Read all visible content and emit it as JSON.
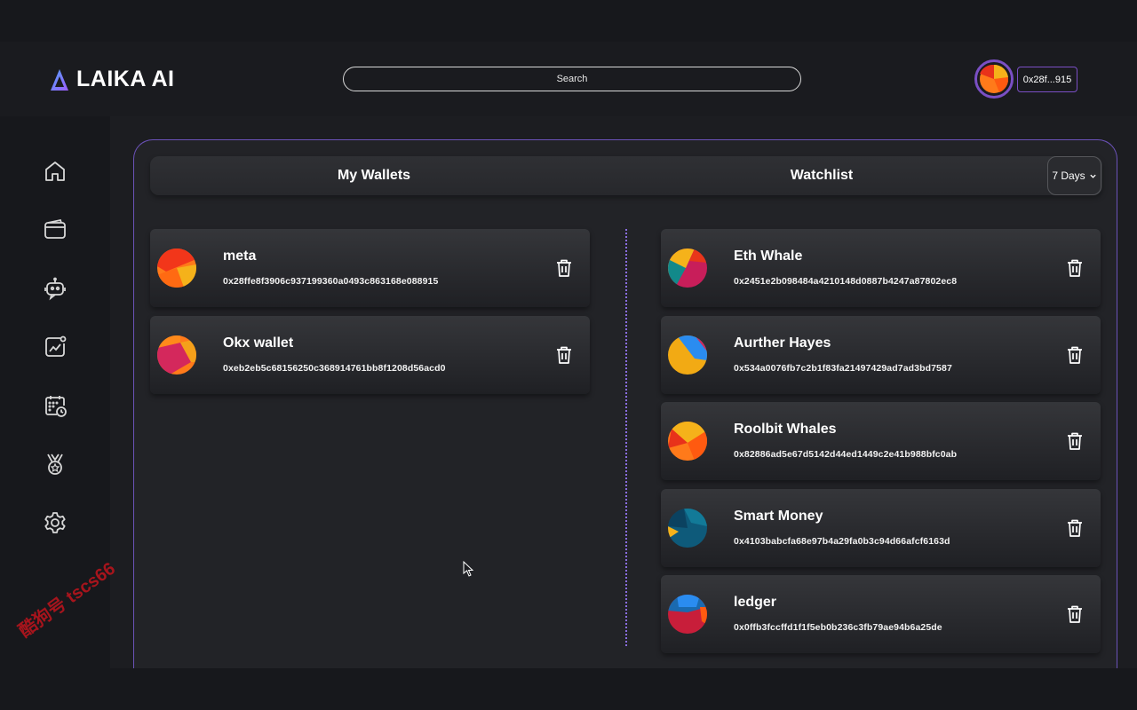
{
  "header": {
    "brand": "LAIKA AI",
    "search_placeholder": "Search",
    "account_address": "0x28f...915"
  },
  "sidebar": {
    "items": [
      {
        "icon": "home-icon"
      },
      {
        "icon": "wallet-icon"
      },
      {
        "icon": "robot-chat-icon"
      },
      {
        "icon": "analytics-icon"
      },
      {
        "icon": "calendar-clock-icon"
      },
      {
        "icon": "medal-icon"
      },
      {
        "icon": "gear-icon"
      }
    ]
  },
  "tabs": {
    "my_wallets": "My Wallets",
    "watchlist": "Watchlist",
    "period": "7 Days"
  },
  "my_wallets": [
    {
      "name": "meta",
      "address": "0x28ffe8f3906c937199360a0493c863168e088915"
    },
    {
      "name": "Okx wallet",
      "address": "0xeb2eb5c68156250c368914761bb8f1208d56acd0"
    }
  ],
  "watchlist": [
    {
      "name": "Eth Whale",
      "address": "0x2451e2b098484a4210148d0887b4247a87802ec8"
    },
    {
      "name": "Aurther Hayes",
      "address": "0x534a0076fb7c2b1f83fa21497429ad7ad3bd7587"
    },
    {
      "name": "Roolbit Whales",
      "address": "0x82886ad5e67d5142d44ed1449c2e41b988bfc0ab"
    },
    {
      "name": "Smart Money",
      "address": "0x4103babcfa68e97b4a29fa0b3c94d66afcf6163d"
    },
    {
      "name": "ledger",
      "address": "0x0ffb3fccffd1f1f5eb0b236c3fb79ae94b6a25de"
    }
  ],
  "watermark": "酷狗号 tscs66"
}
